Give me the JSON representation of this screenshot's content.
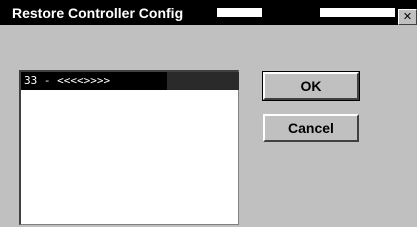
{
  "window": {
    "title": "Restore Controller Config",
    "close_glyph": "✕"
  },
  "config_list": {
    "items": [
      "33 - <<<<>>>>"
    ],
    "selected_index": 0
  },
  "buttons": {
    "ok_label": "OK",
    "cancel_label": "Cancel"
  },
  "colors": {
    "dialog_background": "#c0c0c0",
    "titlebar": "#000000",
    "title_text": "#ffffff",
    "selection": "#000000"
  }
}
